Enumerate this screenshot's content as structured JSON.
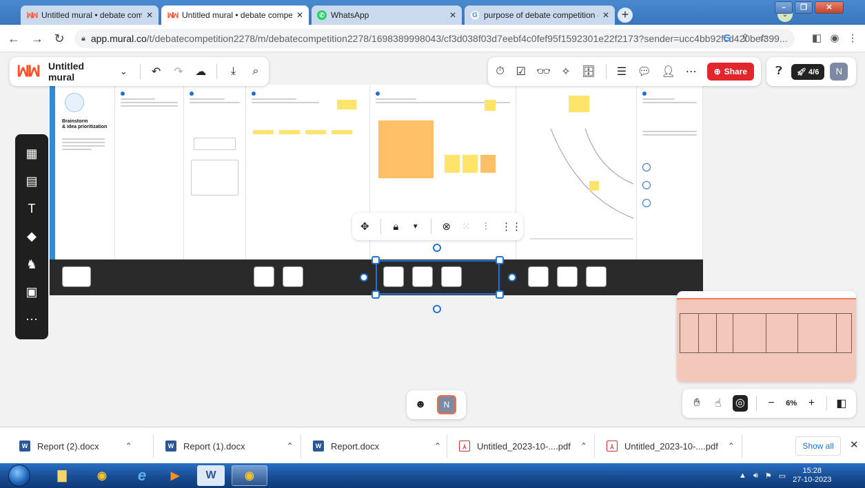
{
  "browser": {
    "tabs": [
      {
        "title": "Untitled mural • debate competit",
        "active": false
      },
      {
        "title": "Untitled mural • debate competit",
        "active": true
      },
      {
        "title": "WhatsApp",
        "active": false
      },
      {
        "title": "purpose of debate competition -",
        "active": false
      }
    ],
    "url_host": "app.mural.co",
    "url_path": "/t/debatecompetition2278/m/debatecompetition2278/1698389998043/cf3d038f03d7eebf4c0fef95f1592301e22f2173?sender=ucc4bb92fcd420bef399..."
  },
  "mural": {
    "title": "Untitled mural",
    "share_label": "Share",
    "timer_label": "4/6",
    "user_initial": "N",
    "board": {
      "intro_title_line1": "Brainstorm",
      "intro_title_line2": "& idea prioritization"
    },
    "zoom": "6%"
  },
  "downloads": {
    "items": [
      {
        "name": "Report (2).docx",
        "type": "word"
      },
      {
        "name": "Report (1).docx",
        "type": "word"
      },
      {
        "name": "Report.docx",
        "type": "word"
      },
      {
        "name": "Untitled_2023-10-....pdf",
        "type": "pdf"
      },
      {
        "name": "Untitled_2023-10-....pdf",
        "type": "pdf"
      }
    ],
    "show_all": "Show all"
  },
  "taskbar": {
    "time": "15:28",
    "date": "27-10-2023"
  },
  "colors": {
    "brand": "#ff4f2a",
    "share": "#e3262b",
    "selection": "#1f73d9",
    "taskbar": "#184c92"
  }
}
